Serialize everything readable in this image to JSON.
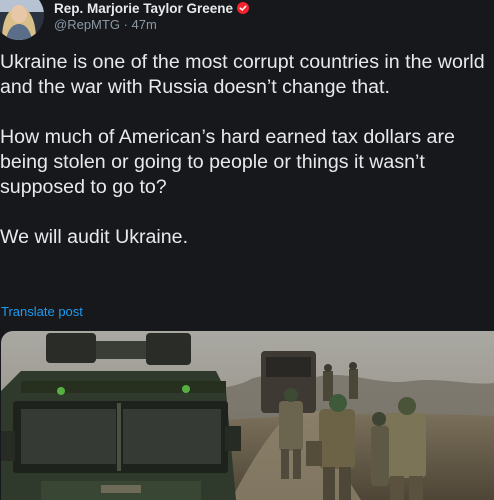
{
  "author": {
    "display_name": "Rep. Marjorie Taylor Greene",
    "handle": "@RepMTG",
    "separator": "·",
    "time_ago": "47m",
    "badge_color": "#f4212e"
  },
  "post": {
    "paragraphs": [
      {
        "lines": [
          "Ukraine is one of the most corrupt countries in the world",
          "and the war with Russia doesn’t change that."
        ]
      },
      {
        "lines": [
          "How much of American’s hard earned tax dollars are",
          "being stolen or going to people or things it wasn’t",
          "supposed to go to?"
        ]
      },
      {
        "lines": [
          "We will audit Ukraine."
        ]
      }
    ],
    "translate_label": "Translate post"
  },
  "colors": {
    "background": "#16181c",
    "text": "#e7e9ea",
    "muted": "#8b98a5",
    "link": "#1d9bf0"
  }
}
